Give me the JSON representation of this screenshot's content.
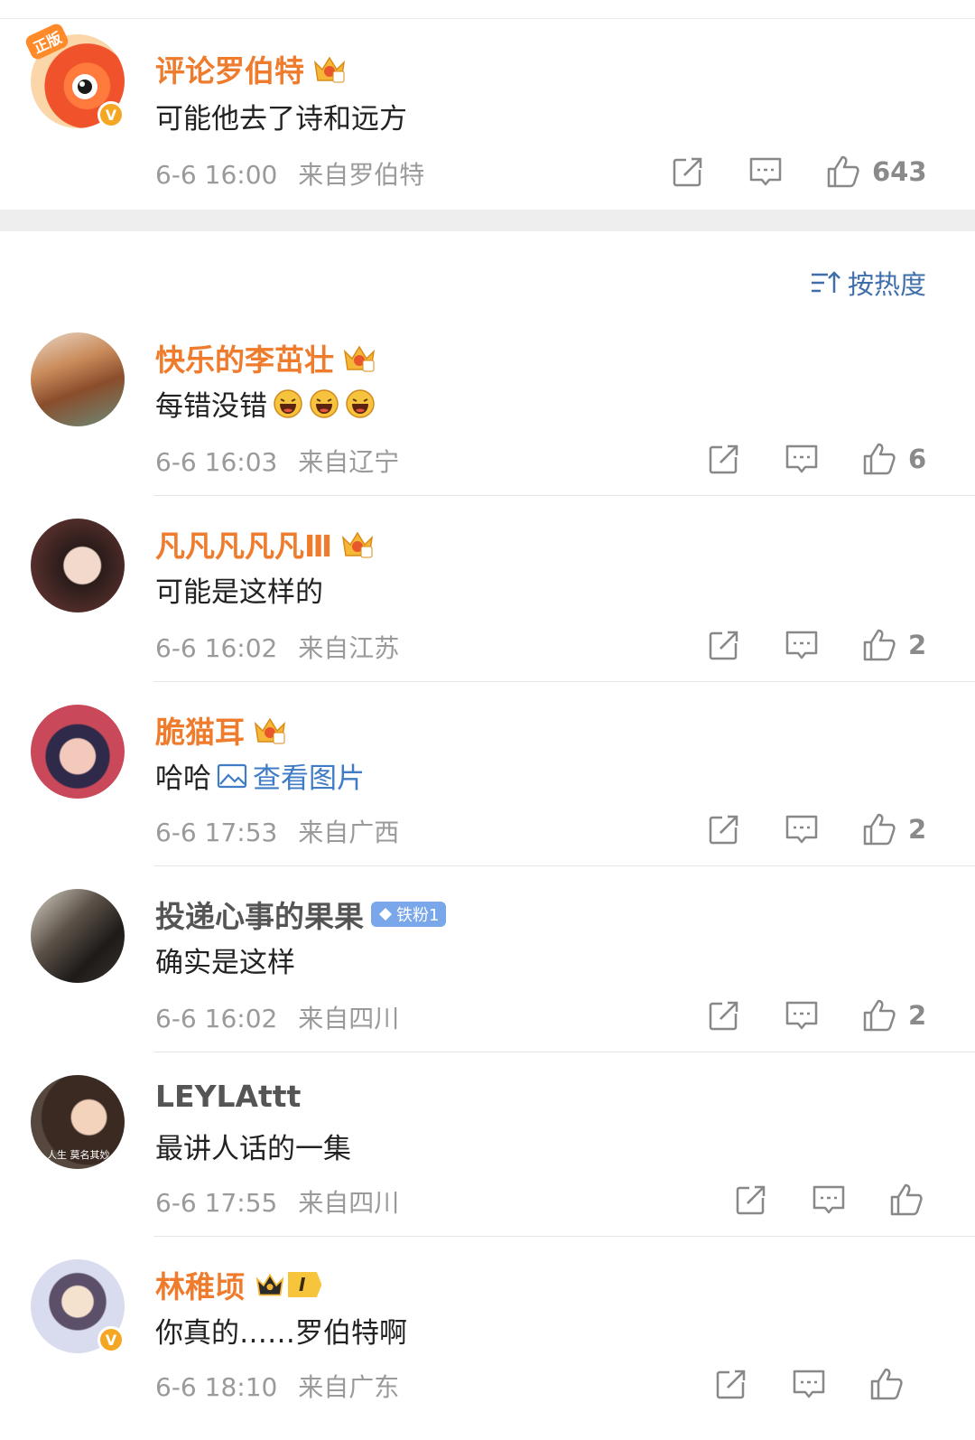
{
  "sort": {
    "label": "按热度"
  },
  "top_comment": {
    "name": "评论罗伯特",
    "text": "可能他去了诗和远方",
    "date": "6-6 16:00",
    "source": "来自罗伯特",
    "likes": "643",
    "avatar_badge": "正版",
    "verified_mark": "V"
  },
  "comments": [
    {
      "name": "快乐的李茁壮",
      "text": "每错没错",
      "date": "6-6 16:03",
      "source": "来自辽宁",
      "likes": "6"
    },
    {
      "name": "凡凡凡凡凡Ⅲ",
      "text": "可能是这样的",
      "date": "6-6 16:02",
      "source": "来自江苏",
      "likes": "2"
    },
    {
      "name": "脆猫耳",
      "text": "哈哈",
      "pic_link": "查看图片",
      "date": "6-6 17:53",
      "source": "来自广西",
      "likes": "2"
    },
    {
      "name": "投递心事的果果",
      "badge": "铁粉1",
      "text": "确实是这样",
      "date": "6-6 16:02",
      "source": "来自四川",
      "likes": "2"
    },
    {
      "name": "LEYLAttt",
      "avatar_caption": "人生 莫名其妙",
      "text": "最讲人话的一集",
      "date": "6-6 17:55",
      "source": "来自四川",
      "likes": ""
    },
    {
      "name": "林稚顷",
      "svip_level": "I",
      "verified_mark": "V",
      "text": "你真的……罗伯特啊",
      "date": "6-6 18:10",
      "source": "来自广东",
      "likes": ""
    }
  ],
  "colors": {
    "name_orange": "#ef7b2d",
    "link_blue": "#3f7cc5",
    "meta_gray": "#9a9a9a",
    "fan_badge": "#7aa7ea"
  },
  "icons": [
    "share-icon",
    "comment-icon",
    "like-icon",
    "crown-icon",
    "sort-icon",
    "image-icon",
    "laugh-emoji-icon",
    "diamond-icon",
    "verified-icon"
  ]
}
